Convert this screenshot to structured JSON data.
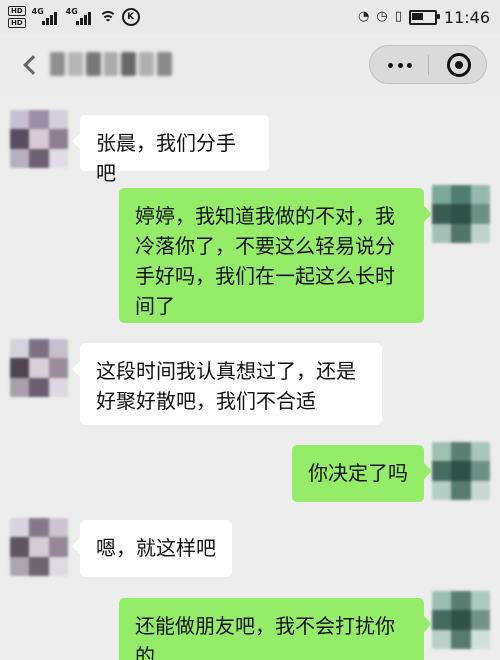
{
  "status_bar": {
    "left_badges": [
      "HD",
      "HD"
    ],
    "signal_labels": [
      "4G",
      "4G"
    ],
    "right_time": "11:46",
    "battery_level": 0.55
  },
  "header": {
    "more_dots": "•••"
  },
  "messages": [
    {
      "side": "left",
      "text": "张晨，我们分手吧"
    },
    {
      "side": "right",
      "text": "婷婷，我知道我做的不对，我冷落你了，不要这么轻易说分手好吗，我们在一起这么长时间了"
    },
    {
      "side": "left",
      "text": "这段时间我认真想过了，还是好聚好散吧，我们不合适"
    },
    {
      "side": "right",
      "text": "你决定了吗"
    },
    {
      "side": "left",
      "text": "嗯，就这样吧"
    },
    {
      "side": "right",
      "text": "还能做朋友吧，我不会打扰你的"
    }
  ],
  "colors": {
    "chat_bg": "#ededed",
    "bubble_white": "#ffffff",
    "bubble_green": "#95ec69",
    "header_bg": "#ececec"
  }
}
